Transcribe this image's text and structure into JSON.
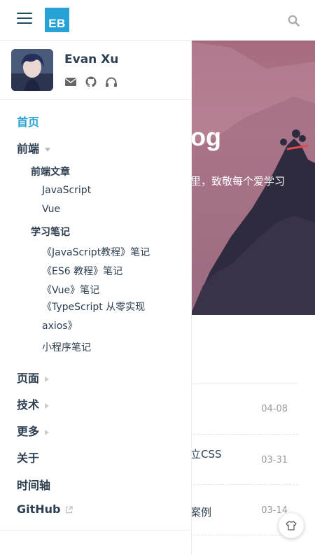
{
  "navbar": {
    "logo_text": "EB"
  },
  "hero": {
    "title_visible": "log",
    "description_visible": "里，致敬每个爱学习"
  },
  "posts": [
    {
      "title": "",
      "date": "04-08"
    },
    {
      "title": "立CSS",
      "date": "03-31"
    },
    {
      "title": "案例",
      "date": "03-14"
    }
  ],
  "sidebar": {
    "blogger": {
      "name": "Evan Xu"
    },
    "social_icons": [
      "mail-icon",
      "github-icon",
      "headphones-icon"
    ],
    "nav": {
      "home": "首页",
      "frontend": "前端",
      "frontend_articles": "前端文章",
      "javascript": "JavaScript",
      "vue": "Vue",
      "study_notes": "学习笔记",
      "note_js": "《JavaScript教程》笔记",
      "note_es6": "《ES6 教程》笔记",
      "note_vue": "《Vue》笔记",
      "note_ts": "《TypeScript 从零实现 axios》",
      "note_miniprogram": "小程序笔记",
      "pages": "页面",
      "tech": "技术",
      "more": "更多",
      "about": "关于",
      "timeline": "时间轴",
      "github": "GitHub"
    }
  },
  "colors": {
    "accent": "#26a2d6",
    "text": "#2c3e50"
  }
}
